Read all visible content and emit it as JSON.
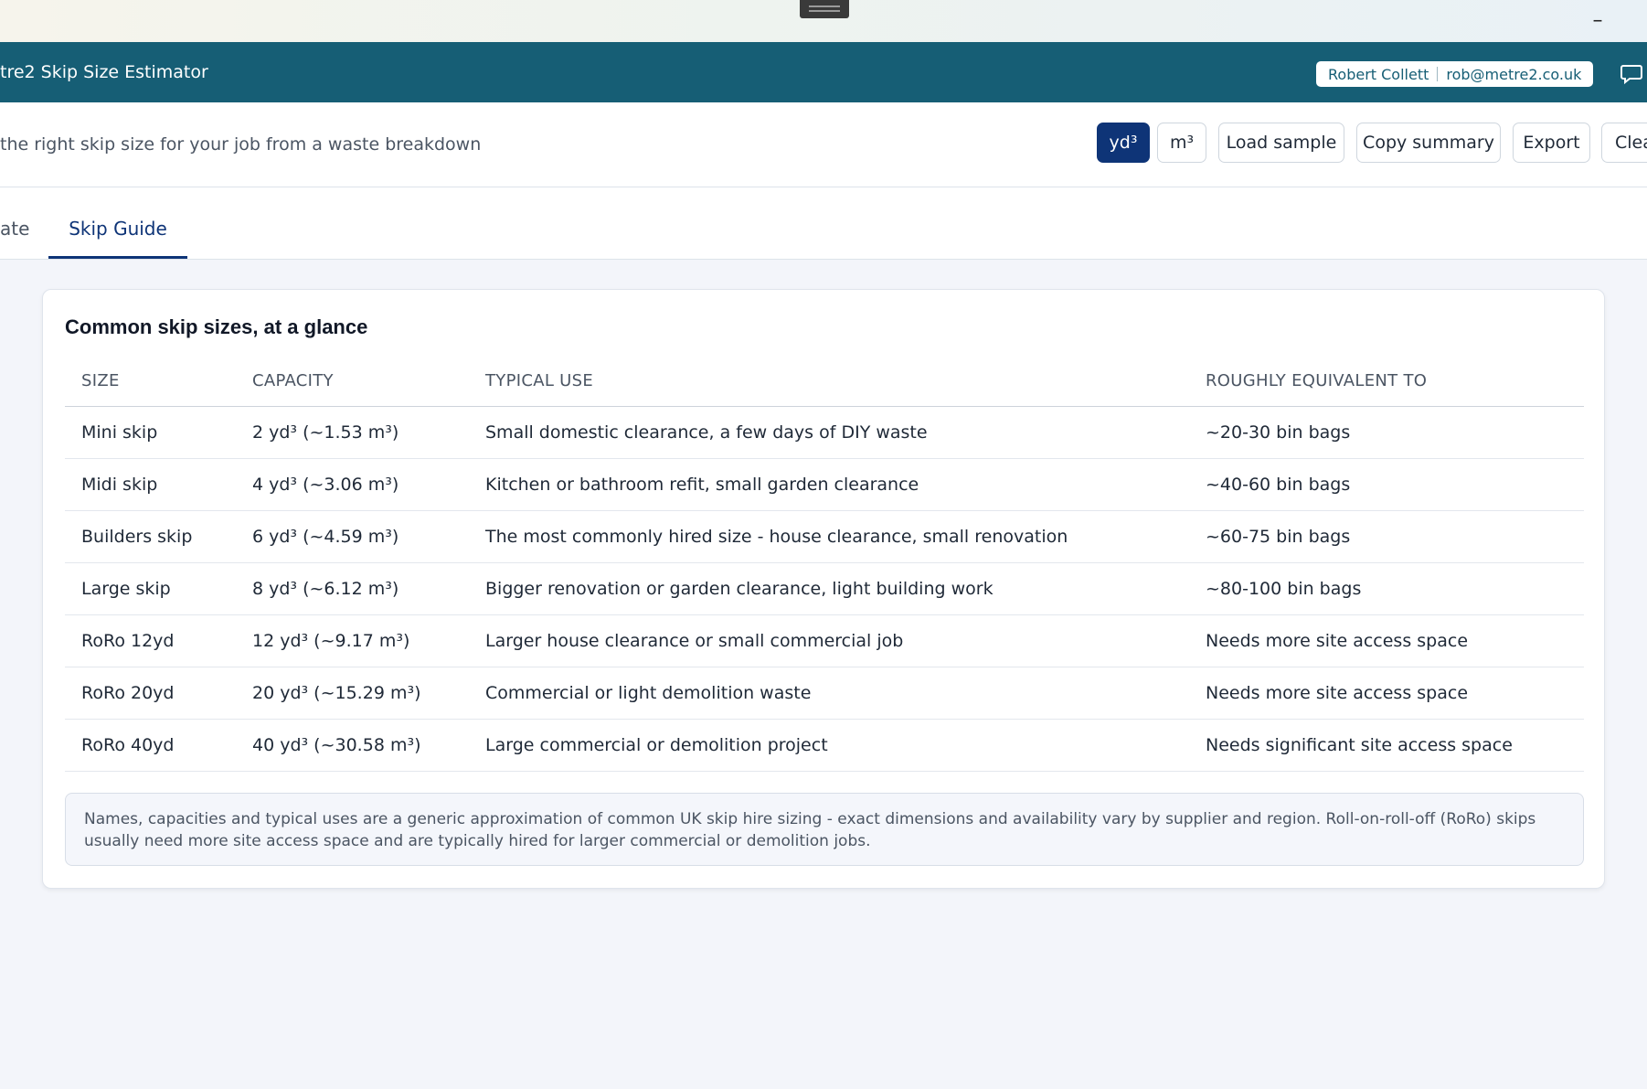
{
  "window": {
    "minimize_glyph": "–"
  },
  "header": {
    "title": "tre2 Skip Size Estimator",
    "user_name": "Robert Collett",
    "user_email": "rob@metre2.co.uk"
  },
  "toolbar": {
    "subtitle": "the right skip size for your job from a waste breakdown",
    "unit_yd": "yd³",
    "unit_m": "m³",
    "load_sample": "Load sample",
    "copy_summary": "Copy summary",
    "export": "Export",
    "clear": "Clea"
  },
  "tabs": [
    {
      "label": "ate",
      "active": false
    },
    {
      "label": "Skip Guide",
      "active": true
    }
  ],
  "guide": {
    "title": "Common skip sizes, at a glance",
    "columns": [
      "SIZE",
      "CAPACITY",
      "TYPICAL USE",
      "ROUGHLY EQUIVALENT TO"
    ],
    "rows": [
      [
        "Mini skip",
        "2 yd³ (~1.53 m³)",
        "Small domestic clearance, a few days of DIY waste",
        "~20-30 bin bags"
      ],
      [
        "Midi skip",
        "4 yd³ (~3.06 m³)",
        "Kitchen or bathroom refit, small garden clearance",
        "~40-60 bin bags"
      ],
      [
        "Builders skip",
        "6 yd³ (~4.59 m³)",
        "The most commonly hired size - house clearance, small renovation",
        "~60-75 bin bags"
      ],
      [
        "Large skip",
        "8 yd³ (~6.12 m³)",
        "Bigger renovation or garden clearance, light building work",
        "~80-100 bin bags"
      ],
      [
        "RoRo 12yd",
        "12 yd³ (~9.17 m³)",
        "Larger house clearance or small commercial job",
        "Needs more site access space"
      ],
      [
        "RoRo 20yd",
        "20 yd³ (~15.29 m³)",
        "Commercial or light demolition waste",
        "Needs more site access space"
      ],
      [
        "RoRo 40yd",
        "40 yd³ (~30.58 m³)",
        "Large commercial or demolition project",
        "Needs significant site access space"
      ]
    ],
    "note": "Names, capacities and typical uses are a generic approximation of common UK skip hire sizing - exact dimensions and availability vary by supplier and region. Roll-on-roll-off (RoRo) skips usually need more site access space and are typically hired for larger commercial or demolition jobs."
  },
  "colors": {
    "header": "#165e75",
    "accent": "#0e3477",
    "background": "#f3f5fa"
  }
}
